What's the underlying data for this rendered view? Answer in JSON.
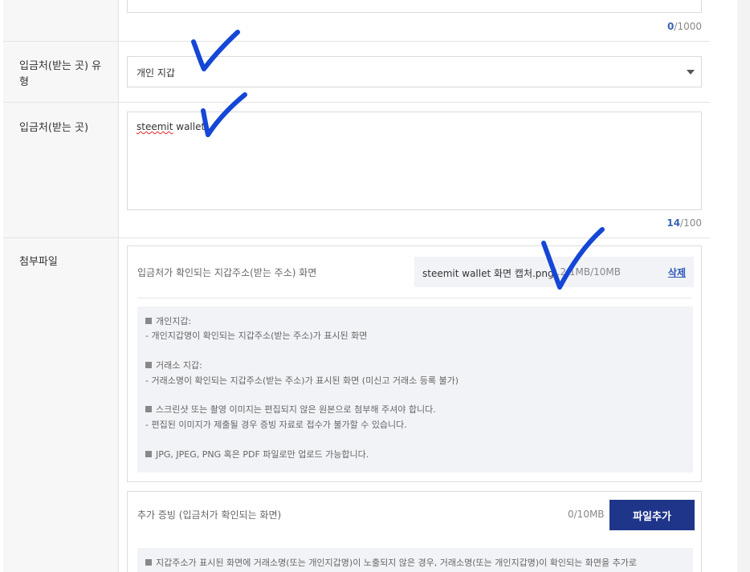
{
  "top_textbox": {
    "counter_current": "0",
    "counter_max": "/1000"
  },
  "deposit_type": {
    "label_line1": "입금처(받는 곳) 유",
    "label_line2": "형",
    "selected": "개인 지갑"
  },
  "destination": {
    "label": "입금처(받는 곳)",
    "value_word1": "steemit",
    "value_word2": " wallet",
    "counter_current": "14",
    "counter_max": "/100"
  },
  "attachment": {
    "label": "첨부파일",
    "panel_title": "입금처가 확인되는 지갑주소(받는 주소) 화면",
    "file_name": "steemit wallet 화면 캡처.png",
    "file_size": "0.2 1MB/10MB",
    "delete_label": "삭제",
    "guide": [
      "개인지갑:",
      "- 개인지갑명이 확인되는 지갑주소(받는 주소)가 표시된 화면",
      "거래소 지갑:",
      "- 거래소명이 확인되는 지갑주소(받는 주소)가 표시된 화면 (미신고 거래소 등록 불가)",
      "스크린샷 또는 촬영 이미지는 편집되지 않은 원본으로 첨부해 주셔야 합니다.",
      "- 편집된 이미지가 제출될 경우 증빙 자료로 접수가 불가할 수 있습니다.",
      "JPG, JPEG, PNG 혹은 PDF 파일로만 업로드 가능합니다."
    ]
  },
  "additional_proof": {
    "title": "추가 증빙 (입금처가 확인되는 화면)",
    "size": "0/10MB",
    "add_button": "파일추가",
    "guide": "지갑주소가 표시된 화면에 거래소명(또는 개인지갑명)이 노출되지 않은 경우, 거래소명(또는 개인지갑명)이 확인되는 화면을 추가로"
  },
  "colors": {
    "accent": "#1e3589",
    "link": "#2a55b9",
    "check_marks": "#1447d6",
    "label_bg": "#f7f7f8",
    "guide_bg": "#f2f3f6"
  }
}
